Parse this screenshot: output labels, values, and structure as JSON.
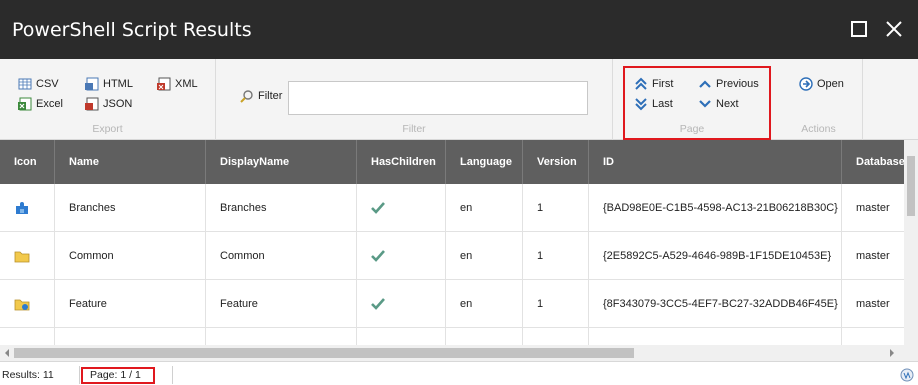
{
  "window": {
    "title": "PowerShell Script Results"
  },
  "ribbon": {
    "export": {
      "csv": "CSV",
      "excel": "Excel",
      "html": "HTML",
      "json": "JSON",
      "xml": "XML",
      "label": "Export"
    },
    "filter": {
      "label_text": "Filter",
      "value": "",
      "group_label": "Filter"
    },
    "page": {
      "first": "First",
      "last": "Last",
      "previous": "Previous",
      "next": "Next",
      "label": "Page"
    },
    "actions": {
      "open": "Open",
      "label": "Actions"
    }
  },
  "table": {
    "columns": [
      "Icon",
      "Name",
      "DisplayName",
      "HasChildren",
      "Language",
      "Version",
      "ID",
      "Database"
    ],
    "rows": [
      {
        "icon": "puzzle-icon",
        "name": "Branches",
        "display_name": "Branches",
        "has_children": true,
        "language": "en",
        "version": "1",
        "id": "{BAD98E0E-C1B5-4598-AC13-21B06218B30C}",
        "database": "master"
      },
      {
        "icon": "folder-icon",
        "name": "Common",
        "display_name": "Common",
        "has_children": true,
        "language": "en",
        "version": "1",
        "id": "{2E5892C5-A529-4646-989B-1F15DE10453E}",
        "database": "master"
      },
      {
        "icon": "feature-folder-icon",
        "name": "Feature",
        "display_name": "Feature",
        "has_children": true,
        "language": "en",
        "version": "1",
        "id": "{8F343079-3CC5-4EF7-BC27-32ADDB46F45E}",
        "database": "master"
      }
    ]
  },
  "status": {
    "results": "Results: 11",
    "page": "Page: 1 / 1"
  },
  "colors": {
    "highlight": "#e0181e",
    "titlebar": "#2b2b2b",
    "header": "#5f5f5f",
    "accent": "#2e6fb8",
    "check": "#5a9a86"
  }
}
